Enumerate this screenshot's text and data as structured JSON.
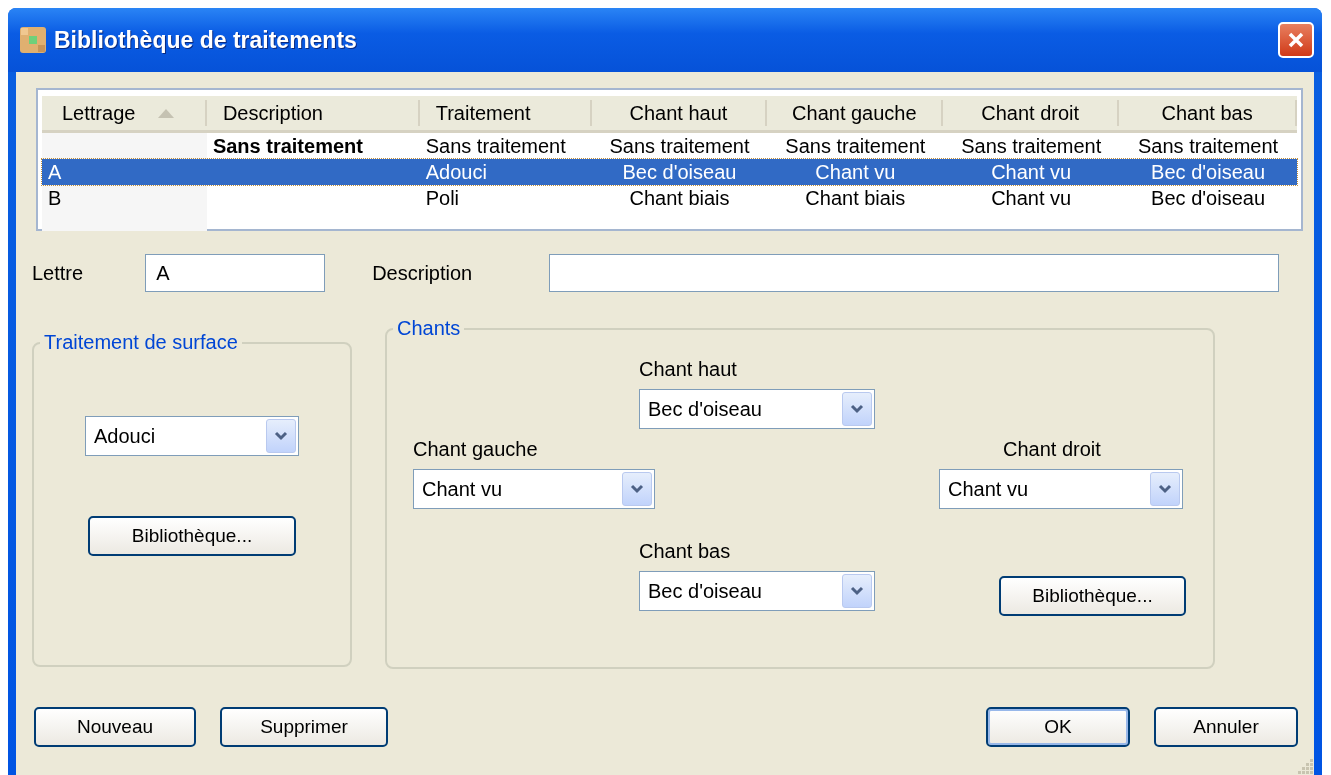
{
  "window": {
    "title": "Bibliothèque de traitements"
  },
  "table": {
    "columns": [
      {
        "label": "Lettrage",
        "sorted": true
      },
      {
        "label": "Description",
        "sorted": false
      },
      {
        "label": "Traitement",
        "sorted": false
      },
      {
        "label": "Chant haut",
        "sorted": false
      },
      {
        "label": "Chant gauche",
        "sorted": false
      },
      {
        "label": "Chant droit",
        "sorted": false
      },
      {
        "label": "Chant bas",
        "sorted": false
      }
    ],
    "rows": [
      {
        "selected": false,
        "bold_description": true,
        "cells": [
          "",
          "Sans traitement",
          "Sans traitement",
          "Sans traitement",
          "Sans traitement",
          "Sans traitement",
          "Sans traitement"
        ]
      },
      {
        "selected": true,
        "cells": [
          "A",
          "",
          "Adouci",
          "Bec d'oiseau",
          "Chant vu",
          "Chant vu",
          "Bec d'oiseau"
        ]
      },
      {
        "selected": false,
        "cells": [
          "B",
          "",
          "Poli",
          "Chant biais",
          "Chant biais",
          "Chant vu",
          "Bec d'oiseau"
        ]
      }
    ]
  },
  "letter": {
    "label": "Lettre",
    "value": "A"
  },
  "description": {
    "label": "Description"
  },
  "surface": {
    "title": "Traitement de surface",
    "value": "Adouci",
    "button": "Bibliothèque..."
  },
  "chants": {
    "title": "Chants",
    "top": {
      "label": "Chant haut",
      "value": "Bec d'oiseau"
    },
    "left": {
      "label": "Chant gauche",
      "value": "Chant vu"
    },
    "right": {
      "label": "Chant droit",
      "value": "Chant vu"
    },
    "bottom": {
      "label": "Chant bas",
      "value": "Bec d'oiseau"
    },
    "button": "Bibliothèque..."
  },
  "buttons_left": [
    "Nouveau",
    "Supprimer"
  ],
  "buttons_right": [
    {
      "label": "OK",
      "default": true
    },
    {
      "label": "Annuler",
      "default": false
    }
  ]
}
